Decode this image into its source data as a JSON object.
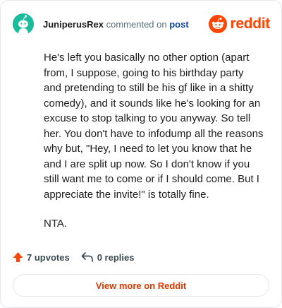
{
  "header": {
    "username": "JuniperusRex",
    "action_text": "commented on",
    "post_link": "post",
    "brand": "reddit",
    "brand_color": "#ff4500",
    "avatar_icon": "snoo-avatar-icon",
    "avatar_color": "#1abc9c"
  },
  "comment": {
    "paragraphs": [
      "He's left you basically no other option (apart from, I suppose, going to his birthday party and pretending to still be his gf like in a shitty comedy), and it sounds like he's looking for an excuse to stop talking to you anyway. So tell her. You don't have to infodump all the reasons why but, \"Hey, I need to let you know that he and I are split up now. So I don't know if you still want me to come or if I should come. But I appreciate the invite!\" is totally fine.",
      "NTA."
    ]
  },
  "actions": {
    "upvotes": "7 upvotes",
    "upvote_icon": "upvote-arrow-icon",
    "upvote_color": "#ff4500",
    "replies": "0 replies",
    "reply_icon": "reply-arrow-icon"
  },
  "footer": {
    "view_more": "View more on Reddit"
  }
}
